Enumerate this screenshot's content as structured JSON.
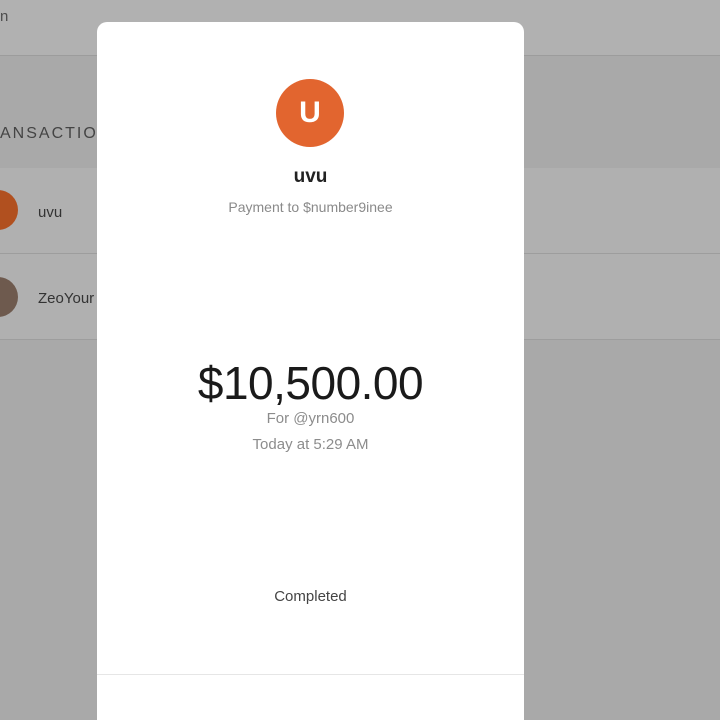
{
  "background": {
    "topbar_text": "n",
    "section_title": "ANSACTION",
    "rows": [
      {
        "name": "uvu"
      },
      {
        "name": "ZeoYour"
      }
    ]
  },
  "modal": {
    "avatar_initial": "U",
    "avatar_color": "#e2652f",
    "recipient_name": "uvu",
    "payment_to": "Payment to $number9inee",
    "amount": "$10,500.00",
    "note": "For @yrn600",
    "timestamp": "Today at 5:29 AM",
    "status": "Completed"
  }
}
